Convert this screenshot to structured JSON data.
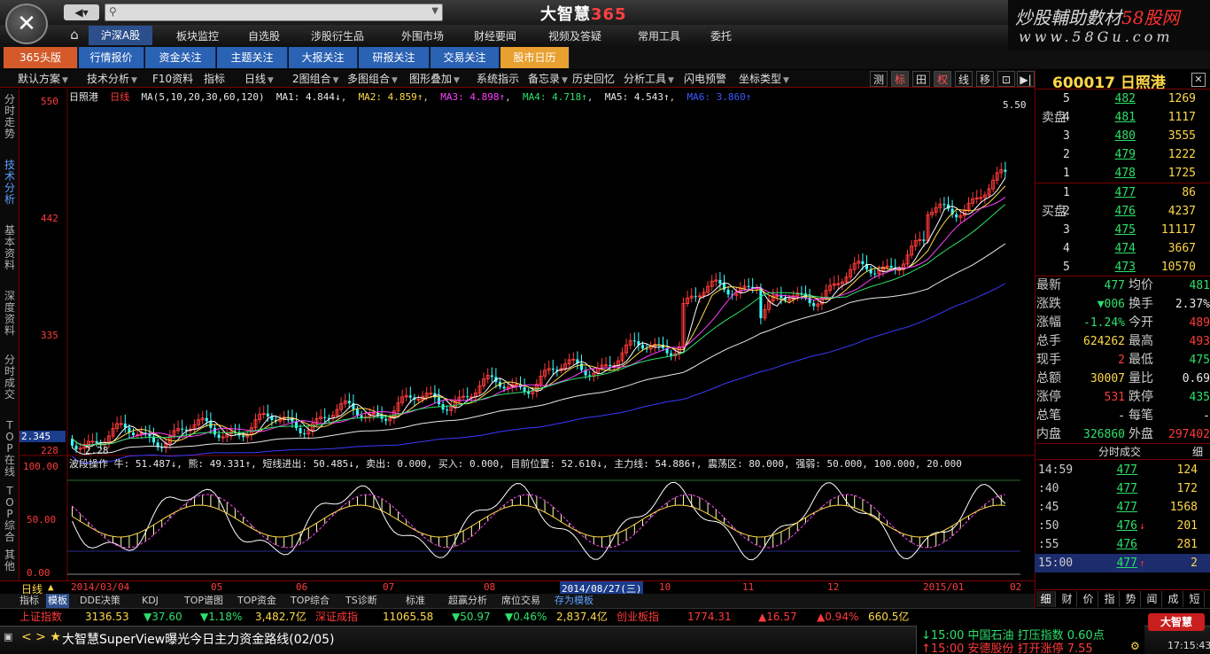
{
  "app": {
    "title_main": "大智慧",
    "title_num": "365",
    "watermark_line1": "炒股輔助數材",
    "watermark_brand": "58股网",
    "watermark_line2": "www.58Gu.com"
  },
  "nav": {
    "back": "◀▾",
    "home_icon": "⌂"
  },
  "menu": [
    "沪深A股",
    "板块监控",
    "自选股",
    "涉股衍生品",
    "外围市场",
    "财经要闻",
    "视频及答疑",
    "常用工具",
    "委托"
  ],
  "tabs": [
    "365头版",
    "行情报价",
    "资金关注",
    "主题关注",
    "大报关注",
    "研报关注",
    "交易关注",
    "股市日历"
  ],
  "toolbar": [
    "默认方案",
    "技术分析",
    "F10资料",
    "指标",
    "日线",
    "2图组合",
    "多图组合",
    "图形叠加",
    "系统指示",
    "备忘录",
    "历史回忆",
    "分析工具",
    "闪电预警",
    "坐标类型"
  ],
  "toolbar_right": [
    "测",
    "标",
    "田",
    "权",
    "线",
    "移",
    "⊡",
    "▶|"
  ],
  "left_tabs": [
    "分时走势",
    "技术分析",
    "基本资料",
    "深度资料",
    "分时成交",
    "TOP在线",
    "TOP综合",
    "其他"
  ],
  "chart": {
    "stock_name": "日照港",
    "period": "日线",
    "ma_label": "MA(5,10,20,30,60,120)",
    "ma1": "MA1: 4.844↓",
    "ma2": "MA2: 4.859↑",
    "ma3": "MA3: 4.898↑",
    "ma4": "MA4: 4.718↑",
    "ma5": "MA5: 4.543↑",
    "ma6": "MA6: 3.860↑",
    "axis_labels": [
      "550",
      "442",
      "335",
      "228"
    ],
    "min_label": "2.345",
    "low_mark": "2.28",
    "high_mark": "5.50",
    "sub_title": "波段操作 牛: 51.487↓, 熊: 49.331↑, 短线进出: 50.485↓, 卖出: 0.000, 买入: 0.000, 目前位置: 52.610↓, 主力线: 54.886↑, 震荡区: 80.000, 强弱: 50.000, 100.000, 20.000",
    "sub_axis": [
      "100.00",
      "50.00",
      "0.00"
    ]
  },
  "dates": {
    "period_label": "日线",
    "labels": [
      "2014/03/04",
      "05",
      "06",
      "07",
      "08",
      "2014/08/27(三)",
      "10",
      "11",
      "12",
      "2015/01",
      "02"
    ]
  },
  "bottom_tabs": [
    "指标",
    "模板",
    "DDE决策",
    "KDJ",
    "TOP谱图",
    "TOP资金",
    "TOP综合",
    "TS诊断",
    "标准",
    "超赢分析",
    "席位交易",
    "存为模板"
  ],
  "ticker": {
    "idx1_name": "上证指数",
    "idx1_val": "3136.53",
    "idx1_chg": "▼37.60",
    "idx1_pct": "▼1.18%",
    "idx1_amt": "3,482.7亿",
    "idx2_name": "深证成指",
    "idx2_val": "11065.58",
    "idx2_chg": "▼50.97",
    "idx2_pct": "▼0.46%",
    "idx2_amt": "2,837.4亿",
    "idx3_name": "创业板指",
    "idx3_val": "1774.31",
    "idx3_chg": "▲16.57",
    "idx3_pct": "▲0.94%",
    "idx3_amt": "660.5亿"
  },
  "status": {
    "headline": "大智慧SuperView曝光今日主力资金路线(02/05)",
    "news1": "↓15:00 中国石油 打压指数 0.60点",
    "news2": "↑15:00 安德股份 打开涨停 7.55",
    "brand": "大智慧",
    "time": "17:15:43"
  },
  "quote": {
    "code": "600017",
    "name": "日照港",
    "sell_label": "卖盘",
    "buy_label": "买盘",
    "sell": [
      {
        "lv": "5",
        "px": "482",
        "vol": "1269"
      },
      {
        "lv": "4",
        "px": "481",
        "vol": "1117"
      },
      {
        "lv": "3",
        "px": "480",
        "vol": "3555"
      },
      {
        "lv": "2",
        "px": "479",
        "vol": "1222"
      },
      {
        "lv": "1",
        "px": "478",
        "vol": "1725"
      }
    ],
    "buy": [
      {
        "lv": "1",
        "px": "477",
        "vol": "86"
      },
      {
        "lv": "2",
        "px": "476",
        "vol": "4237"
      },
      {
        "lv": "3",
        "px": "475",
        "vol": "11117"
      },
      {
        "lv": "4",
        "px": "474",
        "vol": "3667"
      },
      {
        "lv": "5",
        "px": "473",
        "vol": "10570"
      }
    ],
    "stats": [
      {
        "k": "最新",
        "v": "477",
        "vc": "green",
        "k2": "均价",
        "v2": "481",
        "v2c": "green"
      },
      {
        "k": "涨跌",
        "v": "▼006",
        "vc": "green",
        "k2": "换手",
        "v2": "2.37%",
        "v2c": "white"
      },
      {
        "k": "涨幅",
        "v": "-1.24%",
        "vc": "green",
        "k2": "今开",
        "v2": "489",
        "v2c": "red"
      },
      {
        "k": "总手",
        "v": "624262",
        "vc": "yellow",
        "k2": "最高",
        "v2": "493",
        "v2c": "red"
      },
      {
        "k": "现手",
        "v": "2",
        "vc": "red",
        "k2": "最低",
        "v2": "475",
        "v2c": "green"
      },
      {
        "k": "总额",
        "v": "30007",
        "vc": "yellow",
        "k2": "量比",
        "v2": "0.69",
        "v2c": "white"
      },
      {
        "k": "涨停",
        "v": "531",
        "vc": "red",
        "k2": "跌停",
        "v2": "435",
        "v2c": "green"
      },
      {
        "k": "总笔",
        "v": "-",
        "vc": "white",
        "k2": "每笔",
        "v2": "-",
        "v2c": "white"
      },
      {
        "k": "内盘",
        "v": "326860",
        "vc": "green",
        "k2": "外盘",
        "v2": "297402",
        "v2c": "red"
      }
    ],
    "trades_title": "分时成交",
    "trades_detail": "细",
    "trades": [
      {
        "t": "14:59",
        "p": "477",
        "a": "",
        "q": "124"
      },
      {
        "t": ":40",
        "p": "477",
        "a": "",
        "q": "172"
      },
      {
        "t": ":45",
        "p": "477",
        "a": "",
        "q": "1568"
      },
      {
        "t": ":50",
        "p": "476",
        "a": "↓",
        "q": "201"
      },
      {
        "t": ":55",
        "p": "476",
        "a": "",
        "q": "281"
      },
      {
        "t": "15:00",
        "p": "477",
        "a": "↑",
        "q": "2"
      }
    ],
    "bottom_tabs": [
      "细",
      "财",
      "价",
      "指",
      "势",
      "闻",
      "成",
      "短"
    ]
  }
}
